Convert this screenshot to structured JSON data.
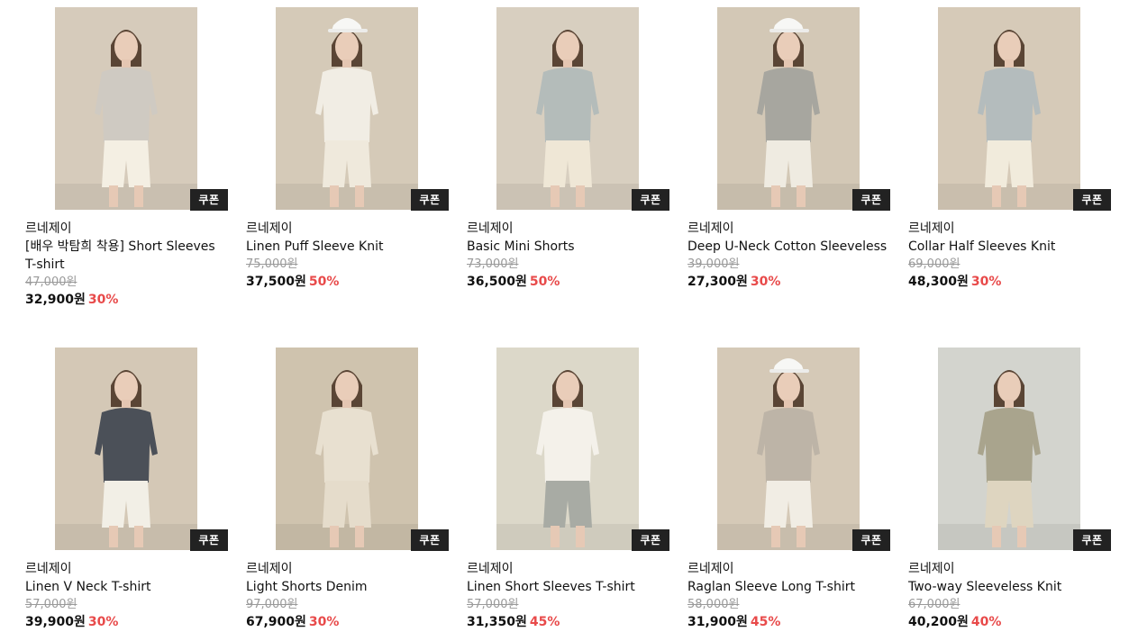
{
  "coupon_label": "쿠폰",
  "colors": {
    "discount": "#e84a4a",
    "coupon_bg": "#222222"
  },
  "products": [
    {
      "brand": "르네제이",
      "name": "[배우 박탐희 착용] Short Sleeves T-shirt",
      "original_price": "47,000원",
      "price": "32,900원",
      "discount": "30%",
      "bg": "#d6cbbb",
      "top": "#cfcac2",
      "bottom": "#f4efe3",
      "cap": false
    },
    {
      "brand": "르네제이",
      "name": "Linen Puff Sleeve Knit",
      "original_price": "75,000원",
      "price": "37,500원",
      "discount": "50%",
      "bg": "#d5cab8",
      "top": "#f1ede4",
      "bottom": "#efe9dc",
      "cap": true
    },
    {
      "brand": "르네제이",
      "name": "Basic Mini Shorts",
      "original_price": "73,000원",
      "price": "36,500원",
      "discount": "50%",
      "bg": "#d8cfc0",
      "top": "#b4bcba",
      "bottom": "#efe7d6",
      "cap": false
    },
    {
      "brand": "르네제이",
      "name": "Deep U-Neck Cotton Sleeveless",
      "original_price": "39,000원",
      "price": "27,300원",
      "discount": "30%",
      "bg": "#d3c8b6",
      "top": "#a7a69f",
      "bottom": "#efebe1",
      "cap": true
    },
    {
      "brand": "르네제이",
      "name": "Collar Half Sleeves Knit",
      "original_price": "69,000원",
      "price": "48,300원",
      "discount": "30%",
      "bg": "#d6cab8",
      "top": "#b4bcbd",
      "bottom": "#f1ebdc",
      "cap": false
    },
    {
      "brand": "르네제이",
      "name": "Linen V Neck T-shirt",
      "original_price": "57,000원",
      "price": "39,900원",
      "discount": "30%",
      "bg": "#d4c8b6",
      "top": "#4b5058",
      "bottom": "#f2efe6",
      "cap": false
    },
    {
      "brand": "르네제이",
      "name": "Light Shorts Denim",
      "original_price": "97,000원",
      "price": "67,900원",
      "discount": "30%",
      "bg": "#cfc3ae",
      "top": "#e8e0d0",
      "bottom": "#e5dccb",
      "cap": false
    },
    {
      "brand": "르네제이",
      "name": "Linen Short Sleeves T-shirt",
      "original_price": "57,000원",
      "price": "31,350원",
      "discount": "45%",
      "bg": "#dcd8c9",
      "top": "#f4f1ea",
      "bottom": "#a8aba4",
      "cap": false
    },
    {
      "brand": "르네제이",
      "name": "Raglan Sleeve Long T-shirt",
      "original_price": "58,000원",
      "price": "31,900원",
      "discount": "45%",
      "bg": "#d5c9b7",
      "top": "#bdb4a7",
      "bottom": "#f1ede4",
      "cap": true
    },
    {
      "brand": "르네제이",
      "name": "Two-way Sleeveless Knit",
      "original_price": "67,000원",
      "price": "40,200원",
      "discount": "40%",
      "bg": "#d3d4ce",
      "top": "#a9a48d",
      "bottom": "#ded5c0",
      "cap": false
    }
  ]
}
